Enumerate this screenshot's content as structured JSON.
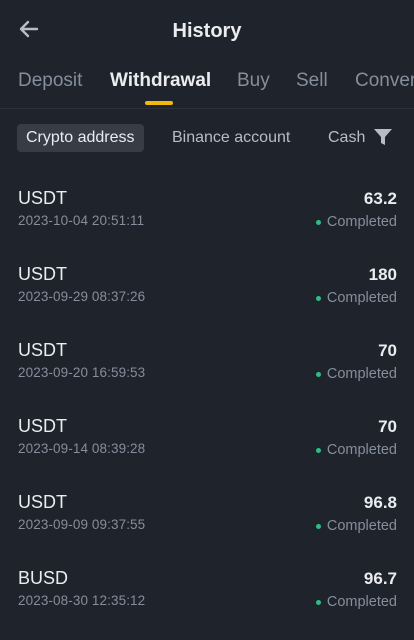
{
  "header": {
    "title": "History",
    "back_icon": "arrow-left-icon"
  },
  "tabs": [
    {
      "label": "Deposit",
      "active": false
    },
    {
      "label": "Withdrawal",
      "active": true
    },
    {
      "label": "Buy",
      "active": false
    },
    {
      "label": "Sell",
      "active": false
    },
    {
      "label": "Conver",
      "active": false
    }
  ],
  "subfilter": {
    "items": [
      {
        "label": "Crypto address",
        "active": true
      },
      {
        "label": "Binance account",
        "active": false
      },
      {
        "label": "Cash",
        "active": false
      }
    ],
    "filter_icon": "funnel-icon"
  },
  "colors": {
    "background": "#1f232b",
    "accent": "#f0b90b",
    "success": "#2ebd85",
    "muted": "#848e9c",
    "text": "#eaecef"
  },
  "transactions": [
    {
      "coin": "USDT",
      "date": "2023-10-04 20:51:11",
      "amount": "63.2",
      "status": "Completed"
    },
    {
      "coin": "USDT",
      "date": "2023-09-29 08:37:26",
      "amount": "180",
      "status": "Completed"
    },
    {
      "coin": "USDT",
      "date": "2023-09-20 16:59:53",
      "amount": "70",
      "status": "Completed"
    },
    {
      "coin": "USDT",
      "date": "2023-09-14 08:39:28",
      "amount": "70",
      "status": "Completed"
    },
    {
      "coin": "USDT",
      "date": "2023-09-09 09:37:55",
      "amount": "96.8",
      "status": "Completed"
    },
    {
      "coin": "BUSD",
      "date": "2023-08-30 12:35:12",
      "amount": "96.7",
      "status": "Completed"
    }
  ]
}
